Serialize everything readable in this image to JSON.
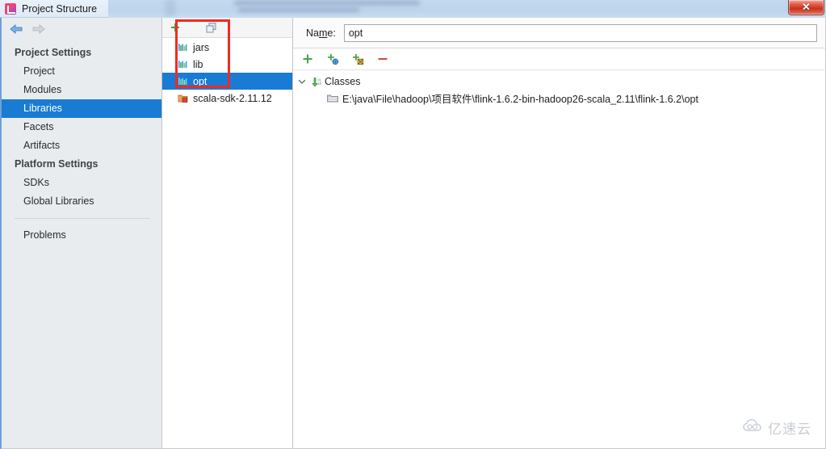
{
  "window": {
    "title": "Project Structure",
    "app_icon": "intellij-idea-icon",
    "close_label": "✕"
  },
  "nav": {
    "back_icon": "arrow-left-icon",
    "forward_icon": "arrow-right-icon"
  },
  "sidebar": {
    "groups": [
      {
        "label": "Project Settings",
        "items": [
          {
            "label": "Project",
            "selected": false
          },
          {
            "label": "Modules",
            "selected": false
          },
          {
            "label": "Libraries",
            "selected": true
          },
          {
            "label": "Facets",
            "selected": false
          },
          {
            "label": "Artifacts",
            "selected": false
          }
        ]
      },
      {
        "label": "Platform Settings",
        "items": [
          {
            "label": "SDKs",
            "selected": false
          },
          {
            "label": "Global Libraries",
            "selected": false
          }
        ]
      }
    ],
    "problems_label": "Problems"
  },
  "library_list": {
    "toolbar": [
      {
        "name": "add-library-button",
        "icon": "plus-icon"
      },
      {
        "name": "copy-library-button",
        "icon": "copy-icon"
      }
    ],
    "items": [
      {
        "label": "jars",
        "icon": "library-jar-icon",
        "selected": false
      },
      {
        "label": "lib",
        "icon": "library-jar-icon",
        "selected": false
      },
      {
        "label": "opt",
        "icon": "library-jar-icon",
        "selected": true
      },
      {
        "label": "scala-sdk-2.11.12",
        "icon": "scala-sdk-icon",
        "selected": false
      }
    ]
  },
  "details": {
    "name_label_pre": "Na",
    "name_label_mnemonic": "m",
    "name_label_post": "e:",
    "name_value": "opt",
    "name_placeholder": "",
    "toolbar": [
      {
        "name": "attach-files-button",
        "icon": "plus-icon",
        "title": "Attach Files or Directories"
      },
      {
        "name": "attach-classes-button",
        "icon": "plus-globe-icon",
        "title": "Attach Classes"
      },
      {
        "name": "attach-external-button",
        "icon": "plus-box-icon",
        "title": "Attach External Annotations"
      },
      {
        "name": "remove-button",
        "icon": "minus-icon",
        "title": "Remove"
      }
    ],
    "tree": {
      "root_label": "Classes",
      "root_icon": "classes-root-icon",
      "expand_icon": "chevron-down-icon",
      "children": [
        {
          "label": "E:\\java\\File\\hadoop\\项目软件\\flink-1.6.2-bin-hadoop26-scala_2.11\\flink-1.6.2\\opt",
          "icon": "folder-icon"
        }
      ]
    }
  },
  "annotation": {
    "shape": "rectangle",
    "color": "#EE2B24"
  },
  "watermark": {
    "text": "亿速云",
    "icon": "cloud-icon"
  },
  "colors": {
    "selection_blue": "#1A7BD4",
    "sidebar_bg": "#E8ECEE",
    "annotation_red": "#EE2B24",
    "close_red": "#C9301C"
  }
}
